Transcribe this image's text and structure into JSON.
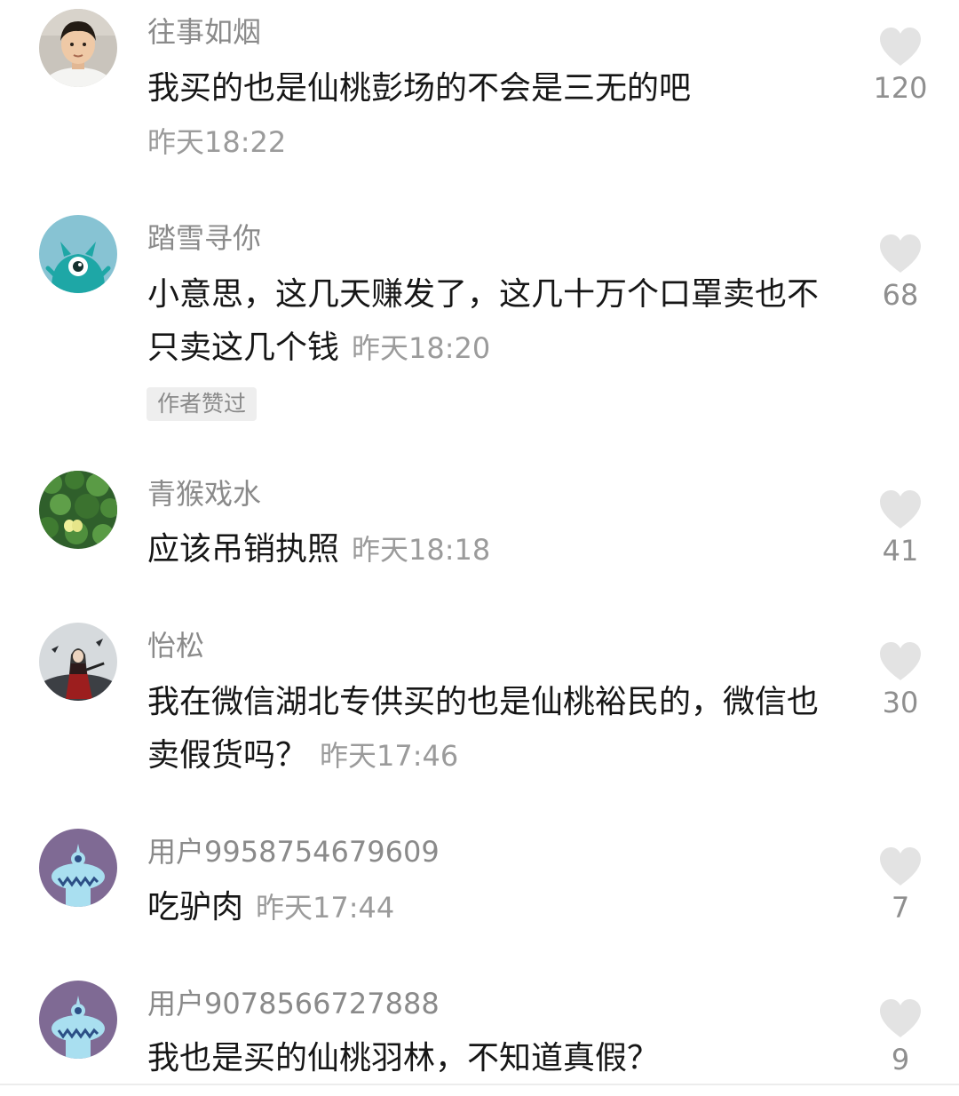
{
  "comments": [
    {
      "username": "往事如烟",
      "text": "我买的也是仙桃彭场的不会是三无的吧",
      "time": "昨天18:22",
      "likes": "120",
      "avatar_icon": "boy-photo-avatar"
    },
    {
      "username": "踏雪寻你",
      "text": "小意思，这几天赚发了，这几十万个口罩卖也不只卖这几个钱",
      "time": "昨天18:20",
      "likes": "68",
      "badge": "作者赞过",
      "avatar_icon": "teal-monster-avatar"
    },
    {
      "username": "青猴戏水",
      "text": "应该吊销执照",
      "time": "昨天18:18",
      "likes": "41",
      "avatar_icon": "green-leaves-avatar"
    },
    {
      "username": "怡松",
      "text": "我在微信湖北专供买的也是仙桃裕民的，微信也卖假货吗？",
      "time": "昨天17:46",
      "likes": "30",
      "avatar_icon": "red-robed-figure-avatar"
    },
    {
      "username": "用户9958754679609",
      "text": "吃驴肉",
      "time": "昨天17:44",
      "likes": "7",
      "avatar_icon": "default-purple-monster-avatar"
    },
    {
      "username": "用户9078566727888",
      "text": "我也是买的仙桃羽林，不知道真假？",
      "likes": "9",
      "avatar_icon": "default-purple-monster-avatar"
    }
  ],
  "icons": {
    "like": "heart-icon"
  },
  "colors": {
    "username": "#8a8a8a",
    "text": "#161616",
    "meta": "#9b9b9b",
    "heart": "#e3e3e3",
    "teal_avatar_bg": "#87c3d3",
    "teal_monster": "#1ea7a6",
    "purple_avatar_bg": "#7f6a94",
    "blue_monster": "#a9dff0"
  }
}
